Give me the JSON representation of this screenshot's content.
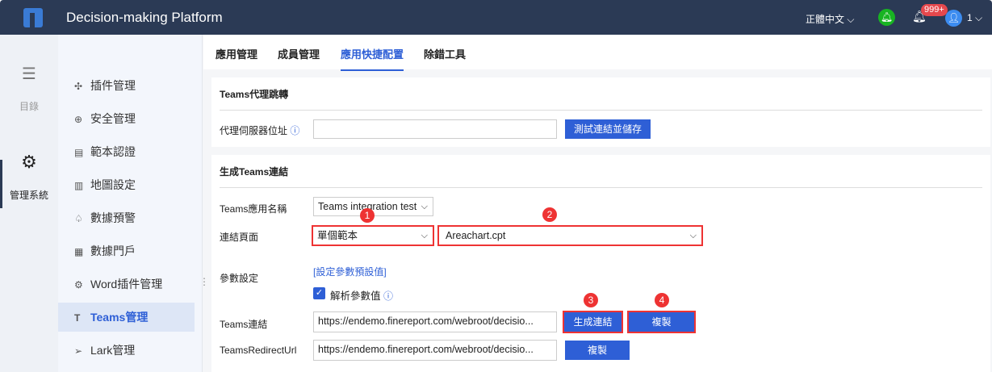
{
  "header": {
    "title": "Decision-making Platform",
    "language": "正體中文",
    "badge": "999+",
    "user": "1"
  },
  "rail": {
    "catalog": "目錄",
    "admin": "管理系統"
  },
  "menu": [
    "插件管理",
    "安全管理",
    "範本認證",
    "地圖設定",
    "數據預警",
    "數據門戶",
    "Word插件管理",
    "Teams管理",
    "Lark管理"
  ],
  "tabs": [
    "應用管理",
    "成員管理",
    "應用快捷配置",
    "除錯工具"
  ],
  "proxy": {
    "title": "Teams代理跳轉",
    "label": "代理伺服器位址",
    "value": "",
    "button": "測試連結並儲存"
  },
  "gen": {
    "title": "生成Teams連結",
    "app_label": "Teams應用名稱",
    "app_value": "Teams integration test",
    "page_label": "連結頁面",
    "page_type": "單個範本",
    "page_file": "Areachart.cpt",
    "param_label": "參數設定",
    "param_link": "[設定參數預設值]",
    "parse_label": "解析參數值",
    "link_label": "Teams連結",
    "link_value": "https://endemo.finereport.com/webroot/decisio...",
    "gen_button": "生成連結",
    "copy_button": "複製",
    "redirect_label": "TeamsRedirectUrl",
    "redirect_value": "https://endemo.finereport.com/webroot/decisio...",
    "copy_button2": "複製"
  },
  "steps": [
    "1",
    "2",
    "3",
    "4"
  ]
}
